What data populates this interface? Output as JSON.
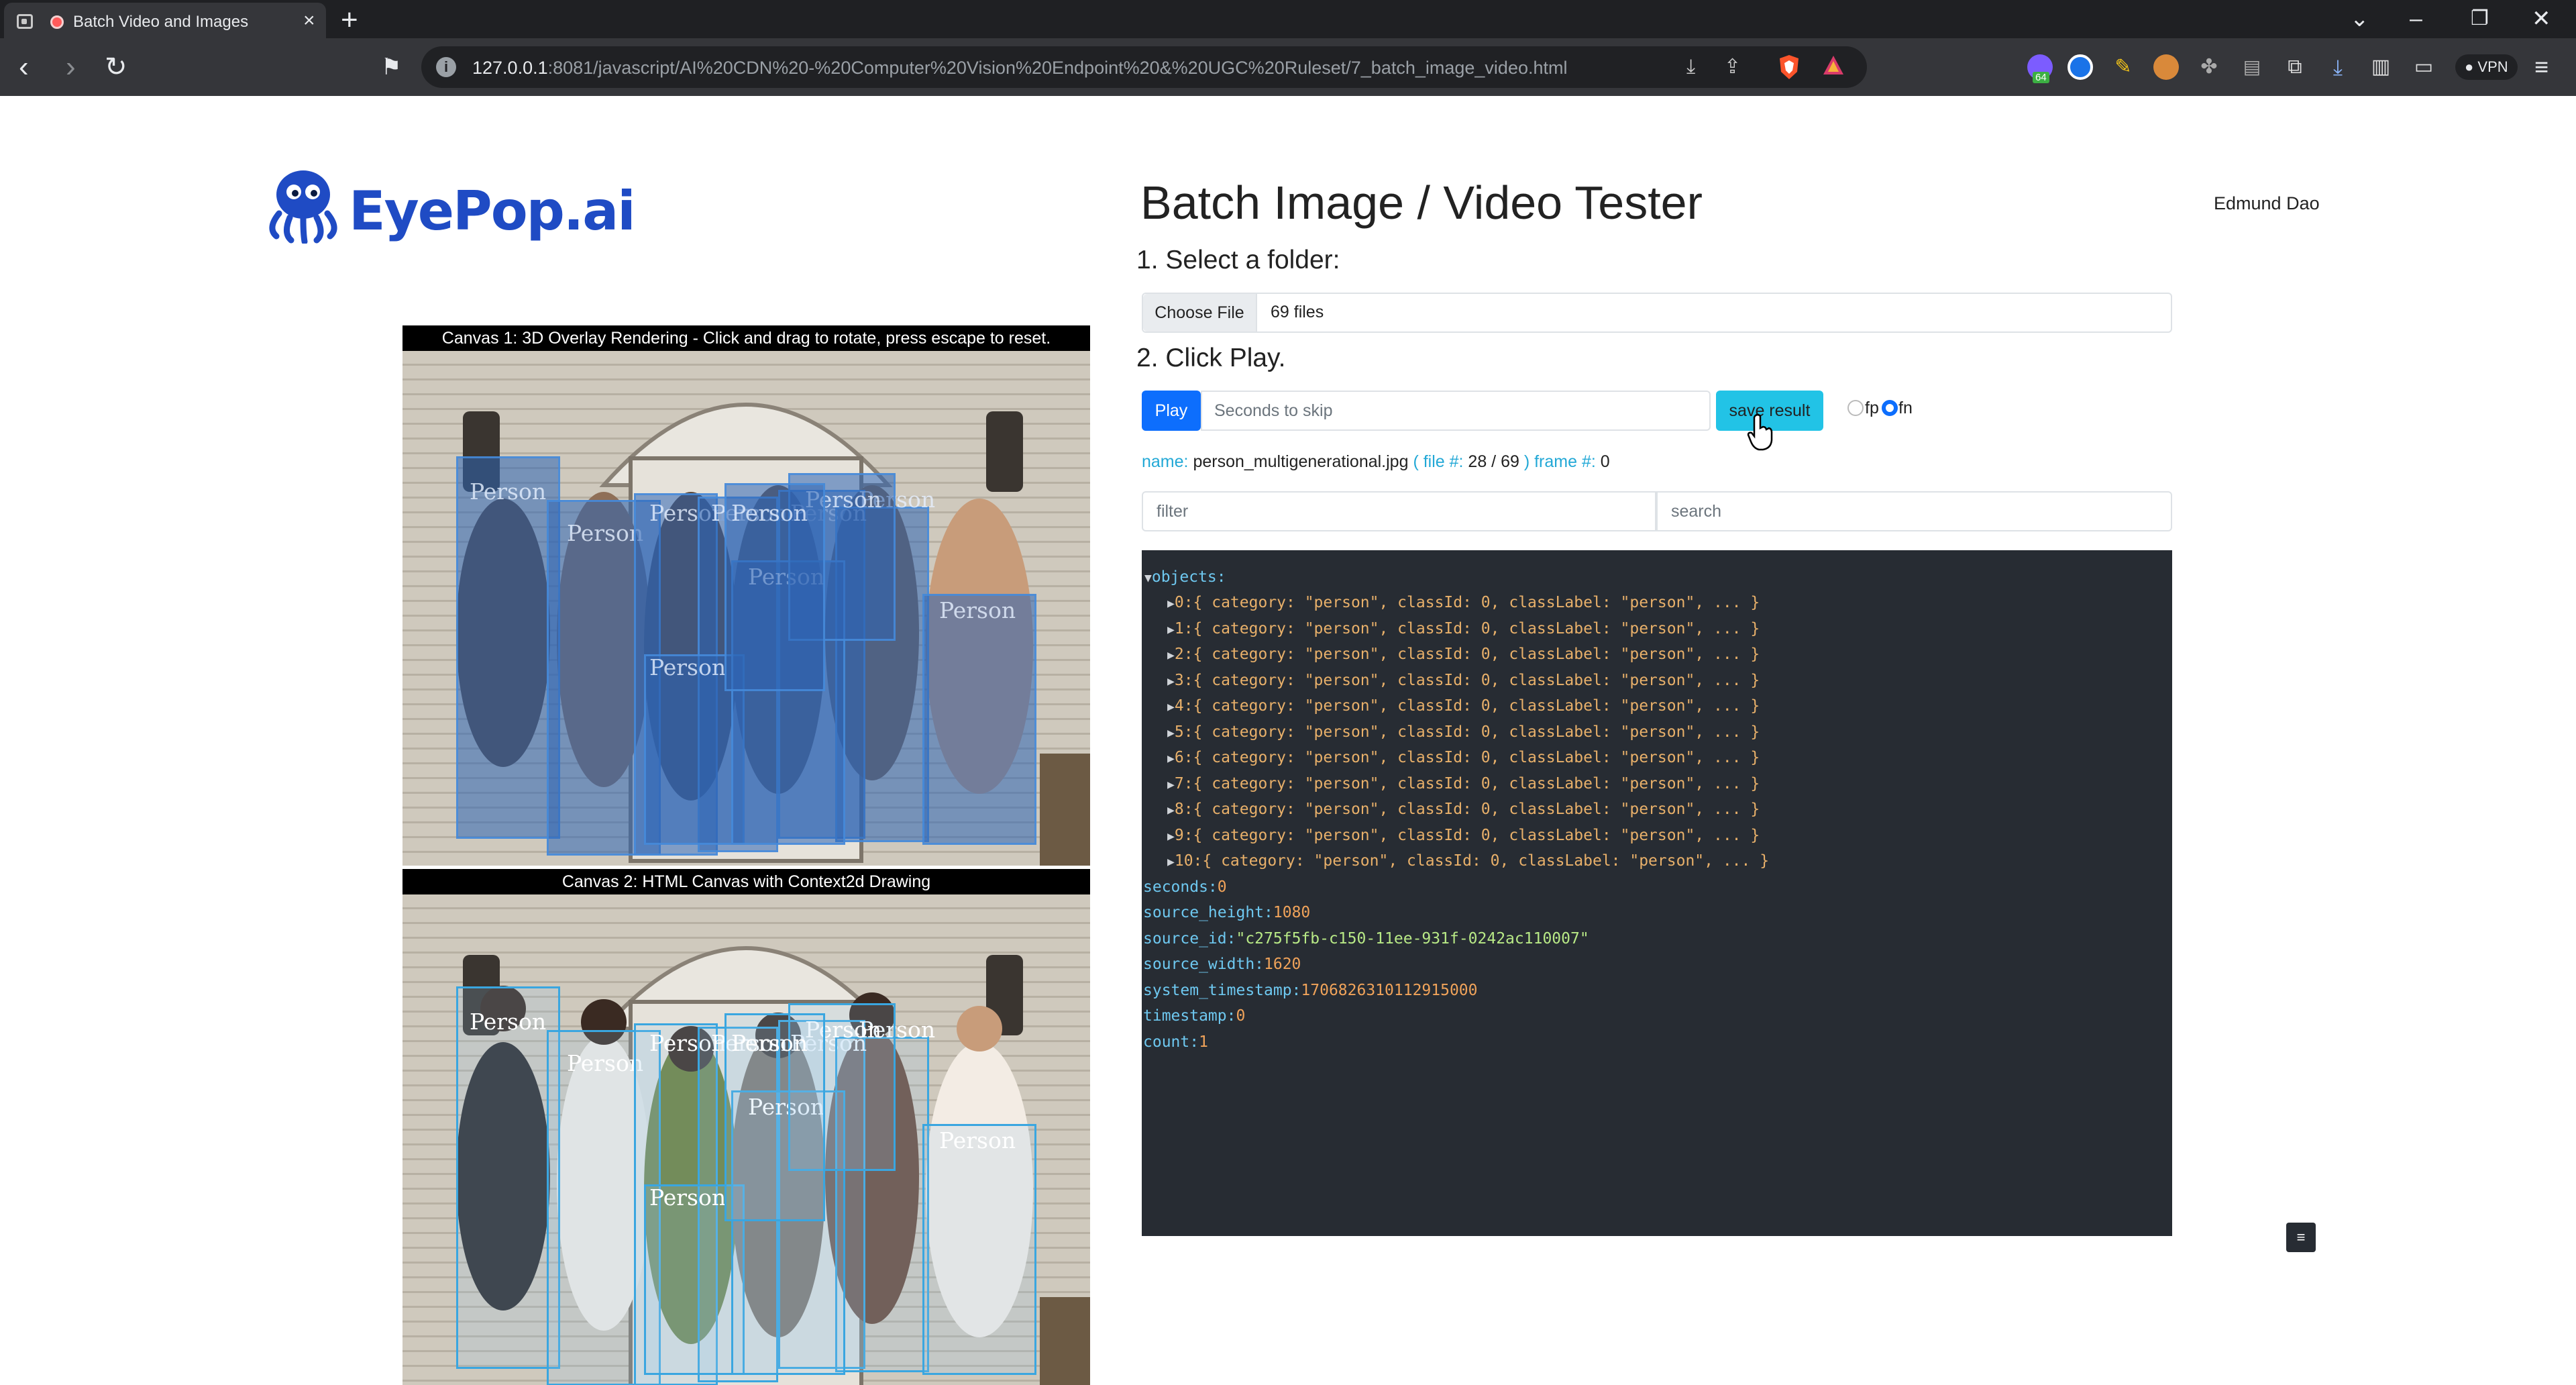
{
  "browser": {
    "tab_title": "Batch Video and Images",
    "url_host": "127.0.0.1",
    "url_rest": ":8081/javascript/AI%20CDN%20-%20Computer%20Vision%20Endpoint%20&%20UGC%20Ruleset/7_batch_image_video.html",
    "vpn_label": "VPN",
    "extension_badge": "64"
  },
  "page": {
    "logo_text": "EyePop.ai",
    "title": "Batch Image / Video Tester",
    "user_name": "Edmund Dao",
    "step1": "1. Select a folder:",
    "choose_file_label": "Choose File",
    "file_count": "69 files",
    "step2": "2. Click Play.",
    "play_label": "Play",
    "skip_placeholder": "Seconds to skip",
    "save_label": "save result",
    "radio_fp_label": "fp",
    "radio_fn_label": "fn",
    "filter_placeholder": "filter",
    "search_placeholder": "search",
    "corner_button": "≡"
  },
  "info": {
    "name_key": "name:",
    "name_value": "person_multigenerational.jpg",
    "file_open": "( file #:",
    "file_value": "28 / 69",
    "frame_key": ") frame #:",
    "frame_value": "0"
  },
  "canvas1": {
    "caption": "Canvas 1: 3D Overlay Rendering - Click and drag to rotate, press escape to reset."
  },
  "canvas2": {
    "caption": "Canvas 2: HTML Canvas with Context2d Drawing"
  },
  "detection_label": "Person",
  "json": {
    "objects_key": "objects:",
    "objects": [
      "0:{ category: \"person\", classId: 0, classLabel: \"person\", ... }",
      "1:{ category: \"person\", classId: 0, classLabel: \"person\", ... }",
      "2:{ category: \"person\", classId: 0, classLabel: \"person\", ... }",
      "3:{ category: \"person\", classId: 0, classLabel: \"person\", ... }",
      "4:{ category: \"person\", classId: 0, classLabel: \"person\", ... }",
      "5:{ category: \"person\", classId: 0, classLabel: \"person\", ... }",
      "6:{ category: \"person\", classId: 0, classLabel: \"person\", ... }",
      "7:{ category: \"person\", classId: 0, classLabel: \"person\", ... }",
      "8:{ category: \"person\", classId: 0, classLabel: \"person\", ... }",
      "9:{ category: \"person\", classId: 0, classLabel: \"person\", ... }",
      "10:{ category: \"person\", classId: 0, classLabel: \"person\", ... }"
    ],
    "fields": [
      {
        "key": "seconds:",
        "value": "0",
        "kind": "num"
      },
      {
        "key": "source_height:",
        "value": "1080",
        "kind": "num"
      },
      {
        "key": "source_id:",
        "value": "\"c275f5fb-c150-11ee-931f-0242ac110007\"",
        "kind": "str"
      },
      {
        "key": "source_width:",
        "value": "1620",
        "kind": "num"
      },
      {
        "key": "system_timestamp:",
        "value": "1706826310112915000",
        "kind": "num"
      },
      {
        "key": "timestamp:",
        "value": "0",
        "kind": "num"
      },
      {
        "key": "count:",
        "value": "1",
        "kind": "num"
      }
    ]
  }
}
